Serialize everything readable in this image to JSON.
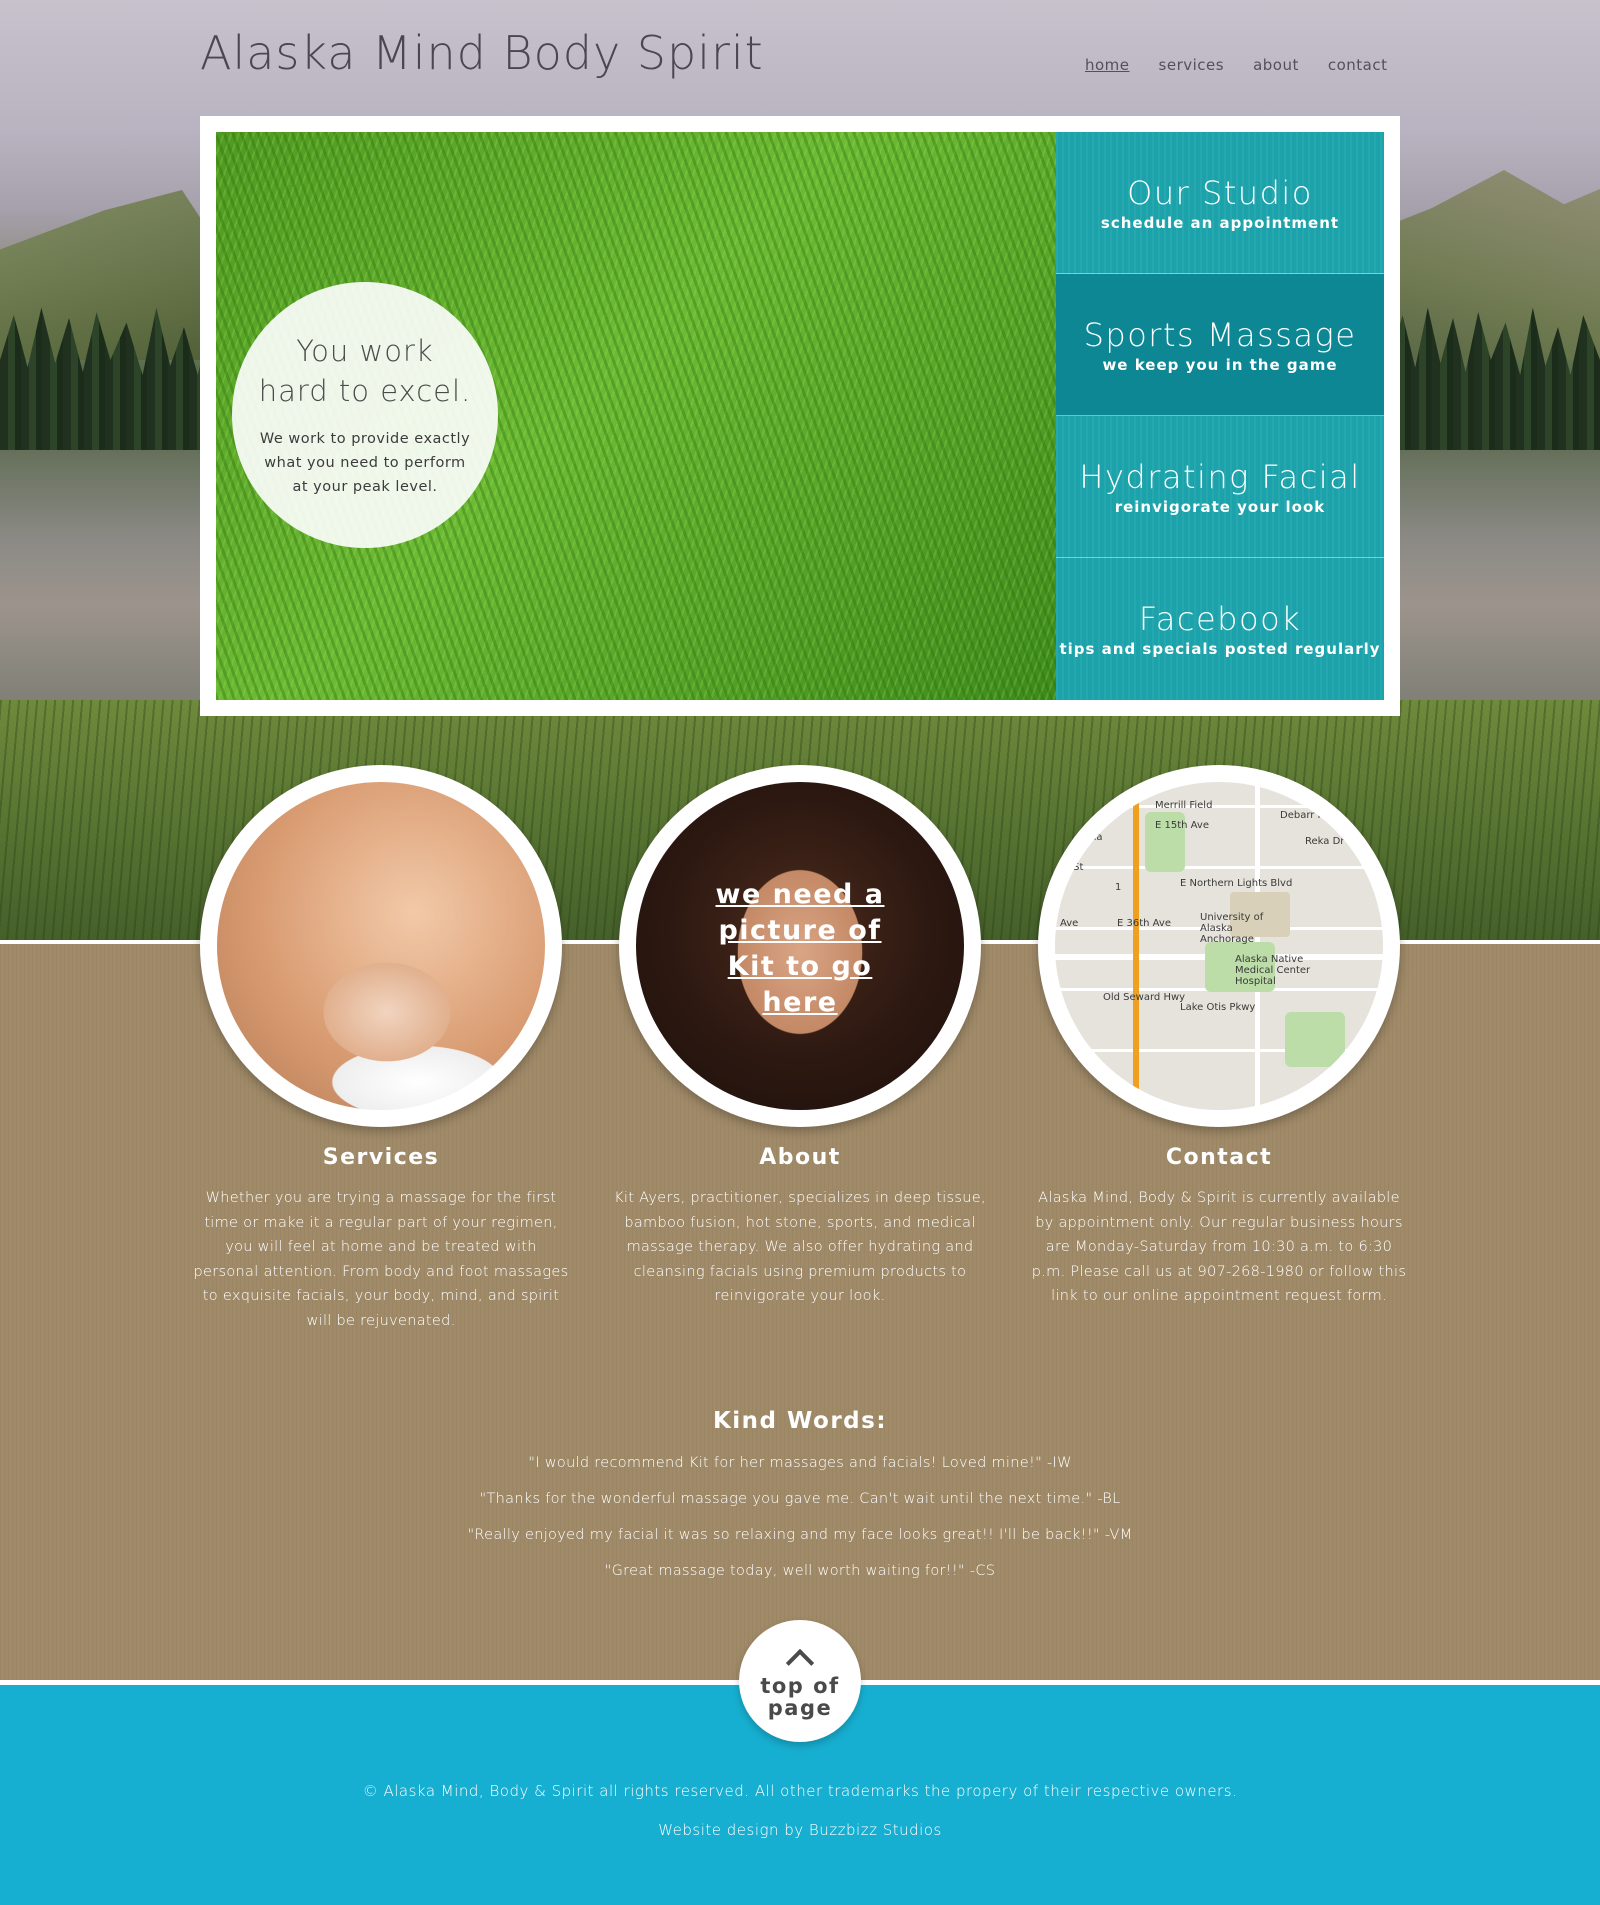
{
  "header": {
    "title": "Alaska Mind Body Spirit",
    "nav": [
      {
        "label": "home",
        "active": true
      },
      {
        "label": "services",
        "active": false
      },
      {
        "label": "about",
        "active": false
      },
      {
        "label": "contact",
        "active": false
      }
    ]
  },
  "hero": {
    "headline_line1": "You work",
    "headline_line2": "hard to excel.",
    "subtext": "We work to provide exactly what you need to perform at your peak level.",
    "panels": [
      {
        "title": "Our Studio",
        "subtitle": "schedule an appointment"
      },
      {
        "title": "Sports Massage",
        "subtitle": "we keep you in the game"
      },
      {
        "title": "Hydrating Facial",
        "subtitle": "reinvigorate your look"
      },
      {
        "title": "Facebook",
        "subtitle": "tips and specials posted regularly"
      }
    ]
  },
  "about_photo_link": "we need a picture of Kit to go here",
  "map_labels": {
    "field": "Merrill Field",
    "ave15": "E 15th Ave",
    "ave36": "E 36th Ave",
    "northern": "E Northern Lights Blvd",
    "university": "University of Alaska Anchorage",
    "hospital": "Alaska Native Medical Center Hospital",
    "seward": "Old Seward Hwy",
    "lakeotis": "Lake Otis Pkwy",
    "debarr": "Debarr Road",
    "reka": "Reka Dr",
    "arena": "rena",
    "cst": "C St",
    "ave": "Ave",
    "route1": "1"
  },
  "columns": [
    {
      "title": "Services",
      "body": "Whether you are trying a massage for the first time or make it a regular part of your regimen, you will feel at home and be treated with personal attention. From body and foot massages to exquisite facials, your body, mind, and spirit will be rejuvenated."
    },
    {
      "title": "About",
      "body": "Kit Ayers, practitioner, specializes in deep tissue, bamboo fusion, hot stone, sports, and medical massage therapy. We also offer hydrating and cleansing facials using premium products to reinvigorate your look."
    },
    {
      "title": "Contact",
      "body": "Alaska Mind, Body & Spirit is currently available by appointment only. Our regular business hours are Monday-Saturday from 10:30 a.m. to 6:30 p.m. Please call us at 907-268-1980 or follow this link to our online appointment request form."
    }
  ],
  "kind_words": {
    "title": "Kind Words:",
    "quotes": [
      "\"I would recommend Kit for her massages and facials! Loved mine!\" -IW",
      "\"Thanks for the wonderful massage you gave me. Can't wait until the next time.\" -BL",
      "\"Really enjoyed my facial it was so relaxing and my face looks great!! I'll be back!!\" -VM",
      "\"Great massage today, well worth waiting for!!\" -CS"
    ]
  },
  "top_button": {
    "label": "top of page",
    "icon": "chevron-up-icon"
  },
  "footer": {
    "copyright": "© Alaska Mind, Body & Spirit all rights reserved.  All other trademarks the propery of their respective owners.",
    "credit": "Website design by Buzzbizz Studios"
  },
  "colors": {
    "teal_panel": "#1ba2aa",
    "teal_panel_dark": "#0e8794",
    "footer_blue": "#17afd1",
    "paper_brown": "#a08a68",
    "title_text": "#4b4650"
  }
}
